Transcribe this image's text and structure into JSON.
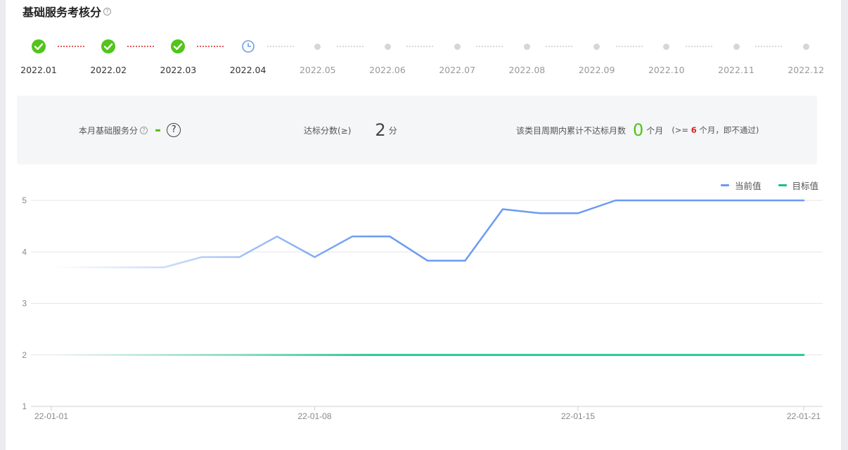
{
  "header": {
    "title": "基础服务考核分",
    "help": "?"
  },
  "steps": [
    {
      "label": "2022.01",
      "status": "done"
    },
    {
      "label": "2022.02",
      "status": "done"
    },
    {
      "label": "2022.03",
      "status": "done"
    },
    {
      "label": "2022.04",
      "status": "current"
    },
    {
      "label": "2022.05",
      "status": "future"
    },
    {
      "label": "2022.06",
      "status": "future"
    },
    {
      "label": "2022.07",
      "status": "future"
    },
    {
      "label": "2022.08",
      "status": "future"
    },
    {
      "label": "2022.09",
      "status": "future"
    },
    {
      "label": "2022.10",
      "status": "future"
    },
    {
      "label": "2022.11",
      "status": "future"
    },
    {
      "label": "2022.12",
      "status": "future"
    }
  ],
  "summary": {
    "monthly_label": "本月基础服务分",
    "monthly_value": "-",
    "monthly_help": "?",
    "target_label": "达标分数(≥)",
    "target_value": "2",
    "target_unit": "分",
    "fail_label": "该类目周期内累计不达标月数",
    "fail_value": "0",
    "fail_unit": "个月",
    "rule_prefix": "(>=",
    "rule_num": "6",
    "rule_suffix": "个月，即不通过)"
  },
  "colors": {
    "accent_green": "#52c41a",
    "current_line": "#6b9bf2",
    "target_line": "#13c28a",
    "alert_red": "#e02020"
  },
  "chart_data": {
    "type": "line",
    "x": [
      "22-01-01",
      "22-01-02",
      "22-01-03",
      "22-01-04",
      "22-01-05",
      "22-01-06",
      "22-01-07",
      "22-01-08",
      "22-01-09",
      "22-01-10",
      "22-01-11",
      "22-01-12",
      "22-01-13",
      "22-01-14",
      "22-01-15",
      "22-01-16",
      "22-01-17",
      "22-01-18",
      "22-01-19",
      "22-01-20",
      "22-01-21"
    ],
    "x_ticks": [
      "22-01-01",
      "22-01-08",
      "22-01-15",
      "22-01-21"
    ],
    "series": [
      {
        "name": "当前值",
        "values": [
          3.7,
          3.7,
          3.7,
          3.7,
          3.9,
          3.9,
          4.3,
          3.9,
          4.3,
          4.3,
          3.83,
          3.83,
          4.83,
          4.75,
          4.75,
          5,
          5,
          5,
          5,
          5,
          5
        ]
      },
      {
        "name": "目标值",
        "values": [
          2,
          2,
          2,
          2,
          2,
          2,
          2,
          2,
          2,
          2,
          2,
          2,
          2,
          2,
          2,
          2,
          2,
          2,
          2,
          2,
          2
        ]
      }
    ],
    "ylim": [
      1,
      5
    ],
    "y_ticks": [
      1,
      2,
      3,
      4,
      5
    ],
    "legend": "top-right",
    "grid": true
  }
}
